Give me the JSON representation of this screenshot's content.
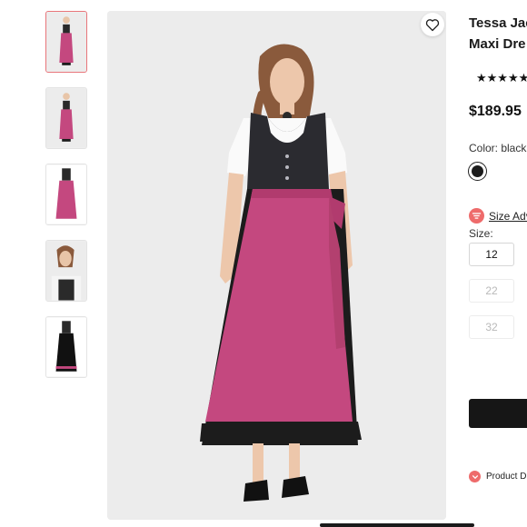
{
  "product": {
    "title_line1": "Tessa Jac",
    "title_line2": "Maxi Dre",
    "rating_stars": "★★★★★",
    "price": "$189.95"
  },
  "color": {
    "label": "Color: black",
    "selected_swatch": "#1c1c1c"
  },
  "size_advisor": {
    "label": "Size Adv",
    "icon": "size-advisor-icon"
  },
  "sizes": {
    "label": "Size:",
    "options": [
      {
        "value": "12",
        "available": true
      },
      {
        "value": "22",
        "available": false
      },
      {
        "value": "32",
        "available": false
      }
    ]
  },
  "details": {
    "label": "Product D",
    "icon": "chevron-down-icon"
  },
  "gallery": {
    "thumbnail_count": 5,
    "active_index": 0,
    "favorite_icon": "heart-icon"
  },
  "colors": {
    "accent": "#ee6b6b",
    "apron_pink": "#c4487f",
    "dress_black": "#1c1c1c"
  }
}
